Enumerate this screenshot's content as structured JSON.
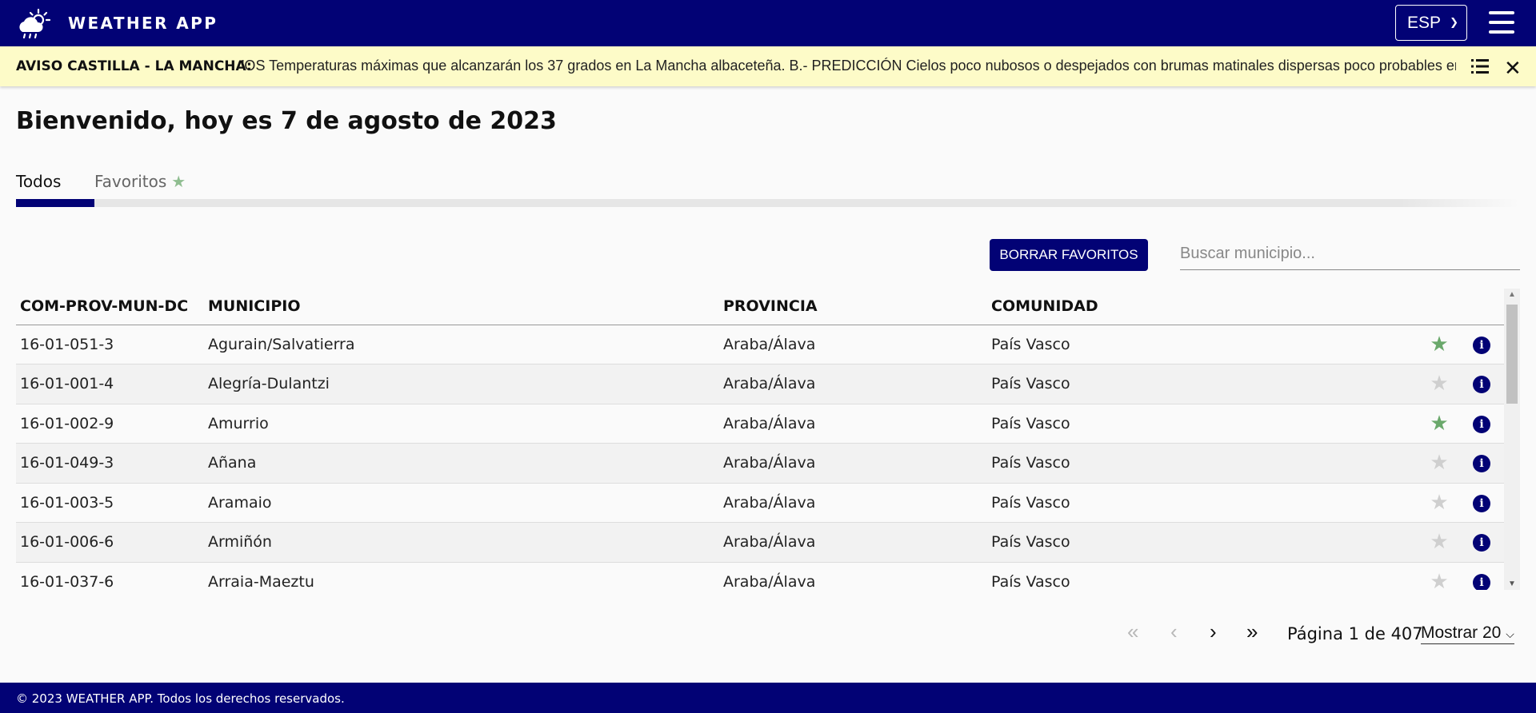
{
  "header": {
    "title": "WEATHER APP",
    "language": "ESP",
    "logo_icon": "cloud-sun-rain-icon",
    "menu_icon": "hamburger-menu-icon"
  },
  "alert": {
    "label": "AVISO CASTILLA - LA MANCHA:",
    "text": "'OS Temperaturas máximas que alcanzarán los 37 grados en La Mancha albaceteña. B.- PREDICCIÓN Cielos poco nubosos o despejados con brumas matinales dispersas poco probables en",
    "list_icon": "list-icon",
    "close_icon": "close-icon"
  },
  "welcome": "Bienvenido, hoy es 7 de agosto de 2023",
  "tabs": [
    {
      "label": "Todos",
      "active": true
    },
    {
      "label": "Favoritos",
      "active": false,
      "icon": "star-icon"
    }
  ],
  "toolbar": {
    "clear_favorites_label": "BORRAR FAVORITOS",
    "search_placeholder": "Buscar municipio..."
  },
  "table": {
    "headers": [
      "COM-PROV-MUN-DC",
      "MUNICIPIO",
      "PROVINCIA",
      "COMUNIDAD"
    ],
    "rows": [
      {
        "code": "16-01-051-3",
        "municipio": "Agurain/Salvatierra",
        "provincia": "Araba/Álava",
        "comunidad": "País Vasco",
        "favorite": true
      },
      {
        "code": "16-01-001-4",
        "municipio": "Alegría-Dulantzi",
        "provincia": "Araba/Álava",
        "comunidad": "País Vasco",
        "favorite": false
      },
      {
        "code": "16-01-002-9",
        "municipio": "Amurrio",
        "provincia": "Araba/Álava",
        "comunidad": "País Vasco",
        "favorite": true
      },
      {
        "code": "16-01-049-3",
        "municipio": "Añana",
        "provincia": "Araba/Álava",
        "comunidad": "País Vasco",
        "favorite": false
      },
      {
        "code": "16-01-003-5",
        "municipio": "Aramaio",
        "provincia": "Araba/Álava",
        "comunidad": "País Vasco",
        "favorite": false
      },
      {
        "code": "16-01-006-6",
        "municipio": "Armiñón",
        "provincia": "Araba/Álava",
        "comunidad": "País Vasco",
        "favorite": false
      },
      {
        "code": "16-01-037-6",
        "municipio": "Arraia-Maeztu",
        "provincia": "Araba/Álava",
        "comunidad": "País Vasco",
        "favorite": false
      }
    ]
  },
  "pagination": {
    "page_label": "Página 1 de 407",
    "page_size": "Mostrar 20",
    "first_icon": "double-chevron-left-icon",
    "prev_icon": "chevron-left-icon",
    "next_icon": "chevron-right-icon",
    "last_icon": "double-chevron-right-icon"
  },
  "footer": "© 2023 WEATHER APP. Todos los derechos reservados.",
  "colors": {
    "primary": "#020275",
    "alert_bg": "#fdfbc8",
    "favorite_on": "#6aa86b",
    "favorite_off": "#cfcfcf"
  }
}
